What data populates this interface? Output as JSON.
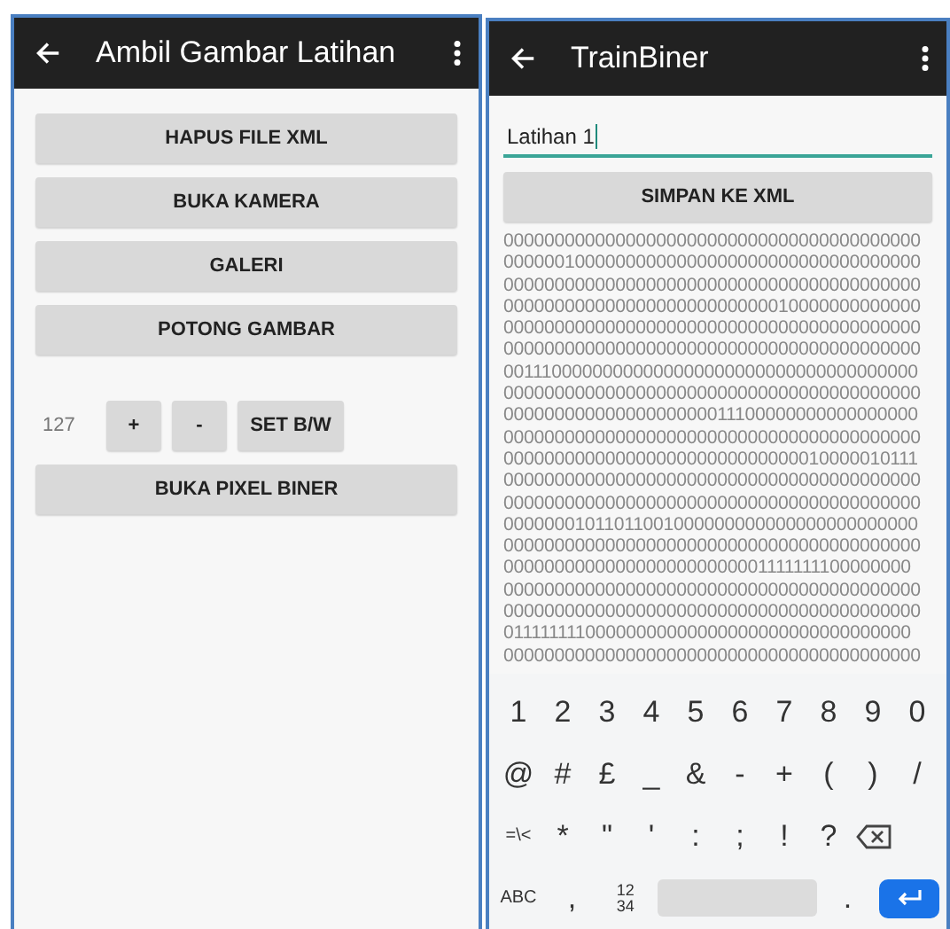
{
  "left": {
    "title": "Ambil Gambar Latihan",
    "buttons": [
      "HAPUS FILE XML",
      "BUKA KAMERA",
      "GALERI",
      "POTONG GAMBAR"
    ],
    "threshold": {
      "value": "127",
      "buttons": [
        "+",
        "-",
        "SET B/W"
      ]
    },
    "bottom_button": "BUKA PIXEL BINER"
  },
  "right": {
    "title": "TrainBiner",
    "name_field": {
      "value": "Latihan 1"
    },
    "save_button": "SIMPAN KE XML",
    "binary_lines": [
      "00000000000000000000000000000000000000000",
      "00000010000000000000000000000000000000000",
      "00000000000000000000000000000000000000000",
      "00000000000000000000000000010000000000000",
      "00000000000000000000000000000000000000000",
      "00000000000000000000000000000000000000000",
      "00111000000000000000000000000000000000000",
      "00000000000000000000000000000000000000000",
      "00000000000000000000011100000000000000000",
      "00000000000000000000000000000000000000000",
      "00000000000000000000000000000010000010111",
      "00000000000000000000000000000000000000000",
      "00000000000000000000000000000000000000000",
      "00000001011011001000000000000000000000000",
      "00000000000000000000000000000000000000000",
      "00000000000000000000000001111111100000000",
      "00000000000000000000000000000000000000000",
      "00000000000000000000000000000000000000000",
      "01111111100000000000000000000000000000000",
      "00000000000000000000000000000000000000000"
    ],
    "keyboard": {
      "rows": [
        [
          {
            "kind": "char",
            "label": "1"
          },
          {
            "kind": "char",
            "label": "2"
          },
          {
            "kind": "char",
            "label": "3"
          },
          {
            "kind": "char",
            "label": "4"
          },
          {
            "kind": "char",
            "label": "5"
          },
          {
            "kind": "char",
            "label": "6"
          },
          {
            "kind": "char",
            "label": "7"
          },
          {
            "kind": "char",
            "label": "8"
          },
          {
            "kind": "char",
            "label": "9"
          },
          {
            "kind": "char",
            "label": "0"
          }
        ],
        [
          {
            "kind": "char",
            "label": "@"
          },
          {
            "kind": "char",
            "label": "#"
          },
          {
            "kind": "char",
            "label": "£"
          },
          {
            "kind": "char",
            "label": "_"
          },
          {
            "kind": "char",
            "label": "&"
          },
          {
            "kind": "char",
            "label": "-"
          },
          {
            "kind": "char",
            "label": "+"
          },
          {
            "kind": "char",
            "label": "("
          },
          {
            "kind": "char",
            "label": ")"
          },
          {
            "kind": "char",
            "label": "/"
          }
        ],
        [
          {
            "kind": "small",
            "label": "=\\<"
          },
          {
            "kind": "char",
            "label": "*"
          },
          {
            "kind": "char",
            "label": "\""
          },
          {
            "kind": "char",
            "label": "'"
          },
          {
            "kind": "char",
            "label": ":"
          },
          {
            "kind": "char",
            "label": ";"
          },
          {
            "kind": "char",
            "label": "!"
          },
          {
            "kind": "char",
            "label": "?"
          },
          {
            "kind": "backspace"
          }
        ],
        [
          {
            "kind": "small",
            "label": "ABC"
          },
          {
            "kind": "char",
            "label": ","
          },
          {
            "kind": "stack",
            "lines": [
              "12",
              "34"
            ]
          },
          {
            "kind": "space"
          },
          {
            "kind": "char",
            "label": "."
          },
          {
            "kind": "enter"
          }
        ]
      ]
    }
  }
}
